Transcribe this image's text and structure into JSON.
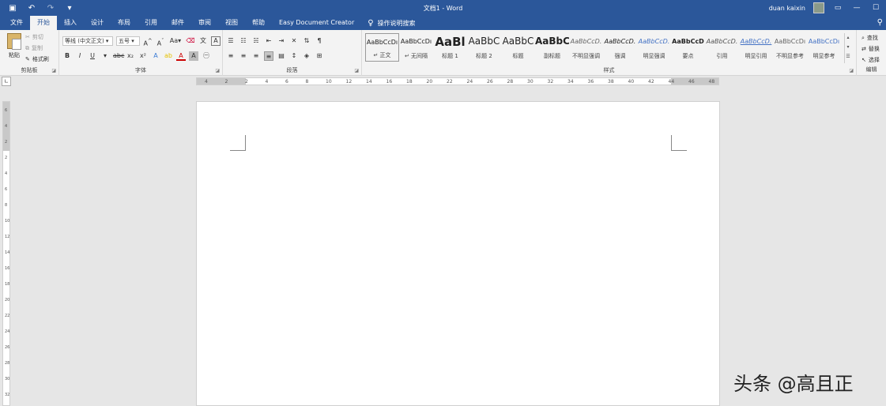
{
  "titlebar": {
    "title": "文档1  -  Word",
    "user": "duan kaixin"
  },
  "tabs": [
    {
      "label": "文件"
    },
    {
      "label": "开始"
    },
    {
      "label": "插入"
    },
    {
      "label": "设计"
    },
    {
      "label": "布局"
    },
    {
      "label": "引用"
    },
    {
      "label": "邮件"
    },
    {
      "label": "审阅"
    },
    {
      "label": "视图"
    },
    {
      "label": "帮助"
    },
    {
      "label": "Easy Document Creator"
    }
  ],
  "tell_me": "操作说明搜索",
  "clipboard": {
    "paste": "粘贴",
    "cut": "剪切",
    "copy": "复制",
    "format_painter": "格式刷",
    "label": "剪贴板"
  },
  "font": {
    "name": "等线 (中文正文)",
    "size": "五号",
    "label": "字体"
  },
  "paragraph": {
    "label": "段落"
  },
  "styles": {
    "label": "样式",
    "items": [
      {
        "preview": "AaBbCcDı",
        "name": "↵ 正文"
      },
      {
        "preview": "AaBbCcDı",
        "name": "↵ 无间隔"
      },
      {
        "preview": "AaBl",
        "name": "标题 1"
      },
      {
        "preview": "AaBbC",
        "name": "标题 2"
      },
      {
        "preview": "AaBbC",
        "name": "标题"
      },
      {
        "preview": "AaBbC",
        "name": "副标题"
      },
      {
        "preview": "AaBbCcD.",
        "name": "不明显强调"
      },
      {
        "preview": "AaBbCcD.",
        "name": "强调"
      },
      {
        "preview": "AaBbCcD.",
        "name": "明显强调"
      },
      {
        "preview": "AaBbCcD",
        "name": "要点"
      },
      {
        "preview": "AaBbCcD.",
        "name": "引用"
      },
      {
        "preview": "AaBbCcD.",
        "name": "明显引用"
      },
      {
        "preview": "AaBbCcDı",
        "name": "不明显参考"
      },
      {
        "preview": "AaBbCcDı",
        "name": "明显参考"
      }
    ]
  },
  "editing": {
    "find": "查找",
    "replace": "替换",
    "select": "选择",
    "label": "编辑"
  },
  "ruler": {
    "h_ticks": [
      "4",
      "2",
      "2",
      "4",
      "6",
      "8",
      "10",
      "12",
      "14",
      "16",
      "18",
      "20",
      "22",
      "24",
      "26",
      "28",
      "30",
      "32",
      "34",
      "36",
      "38",
      "40",
      "42",
      "44",
      "46",
      "48"
    ],
    "v_ticks": [
      "6",
      "4",
      "2",
      "2",
      "4",
      "6",
      "8",
      "10",
      "12",
      "14",
      "16",
      "18",
      "20",
      "22",
      "24",
      "26",
      "28",
      "30",
      "32"
    ]
  },
  "watermark": "头条 @高且正"
}
